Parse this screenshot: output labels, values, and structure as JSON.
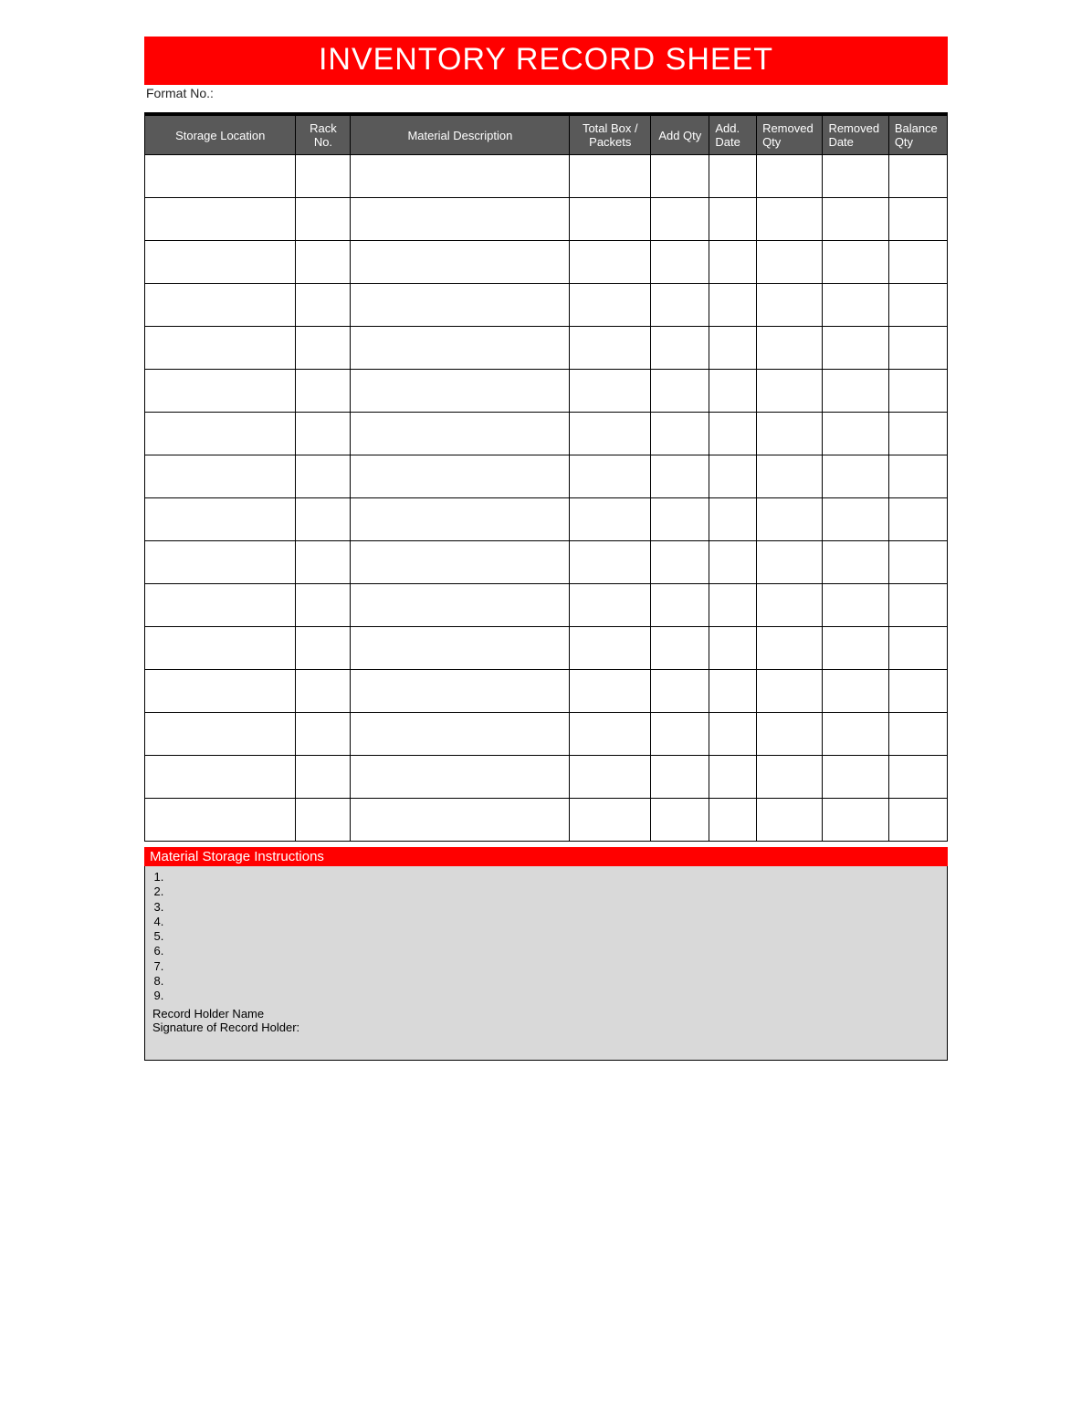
{
  "colors": {
    "accent_red": "#ff0000",
    "header_gray": "#595959",
    "instructions_bg": "#d9d9d9"
  },
  "title": "INVENTORY RECORD SHEET",
  "format_no_label": "Format No.:",
  "columns": {
    "storage_location": "Storage Location",
    "rack_no": "Rack No.",
    "material_description": "Material Description",
    "total_box_packets": "Total Box / Packets",
    "add_qty": "Add Qty",
    "add_date": "Add. Date",
    "removed_qty": "Removed Qty",
    "removed_date": "Removed Date",
    "balance_qty": "Balance Qty"
  },
  "row_count": 16,
  "instructions": {
    "header": "Material Storage Instructions",
    "items": [
      "",
      "",
      "",
      "",
      "",
      "",
      "",
      "",
      ""
    ]
  },
  "record_holder_name_label": "Record Holder Name",
  "signature_label": "Signature of Record Holder:"
}
